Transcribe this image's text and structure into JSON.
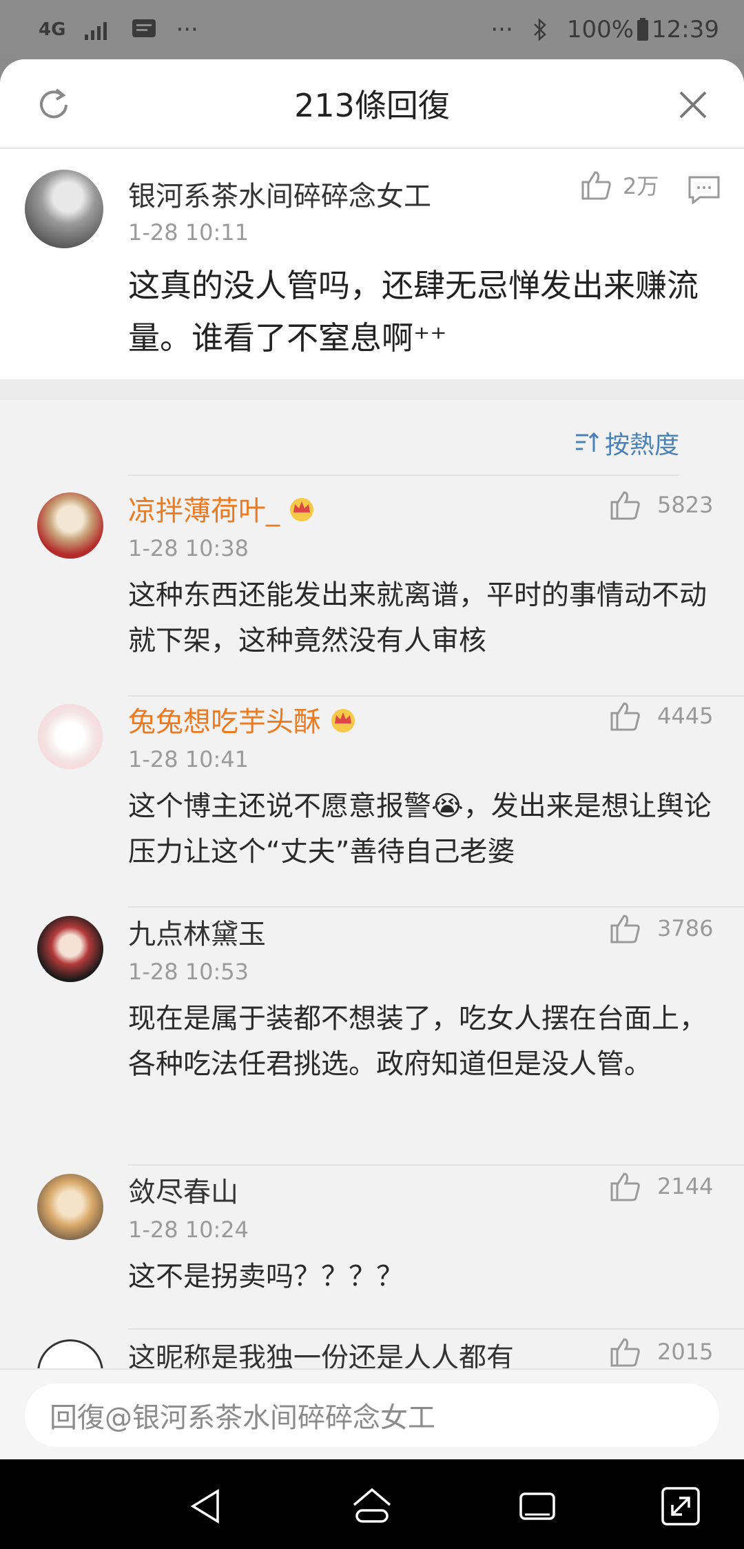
{
  "status_bar": {
    "network": "4G",
    "battery": "100%",
    "time": "12:39"
  },
  "sheet": {
    "title": "213條回復"
  },
  "main_comment": {
    "author": "银河系茶水间碎碎念女工",
    "time": "1-28 10:11",
    "likes": "2万",
    "text": "这真的没人管吗，还肆无忌惮发出来赚流量。谁看了不窒息啊⁺⁺"
  },
  "sort": {
    "label": "按熱度"
  },
  "replies": [
    {
      "author": "凉拌薄荷叶_",
      "vip": true,
      "time": "1-28 10:38",
      "likes": "5823",
      "text": "这种东西还能发出来就离谱，平时的事情动不动就下架，这种竟然没有人审核"
    },
    {
      "author": "兔兔想吃芋头酥",
      "vip": true,
      "time": "1-28 10:41",
      "likes": "4445",
      "text": "这个博主还说不愿意报警😭，发出来是想让舆论压力让这个“丈夫”善待自己老婆"
    },
    {
      "author": "九点林黛玉",
      "vip": false,
      "time": "1-28 10:53",
      "likes": "3786",
      "text": "现在是属于装都不想装了，吃女人摆在台面上，各种吃法任君挑选。政府知道但是没人管。"
    },
    {
      "author": "敛尽春山",
      "vip": false,
      "time": "1-28 10:24",
      "likes": "2144",
      "text": "这不是拐卖吗？？？？"
    },
    {
      "author": "这昵称是我独一份还是人人都有",
      "vip": false,
      "time": "",
      "likes": "2015",
      "text": ""
    }
  ],
  "reply_input": {
    "placeholder": "回復@银河系茶水间碎碎念女工"
  },
  "colors": {
    "vip_name": "#ef7a1e",
    "link": "#4a82b8"
  }
}
